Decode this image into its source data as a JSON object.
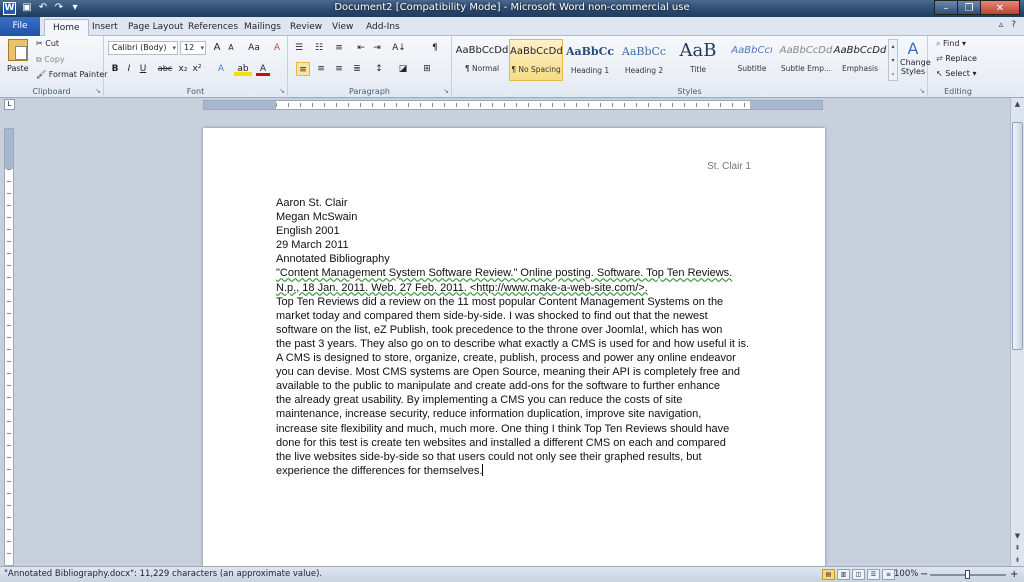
{
  "window": {
    "title": "Document2 [Compatibility Mode] - Microsoft Word non-commercial use",
    "app_icon": "W"
  },
  "tabs": [
    "File",
    "Home",
    "Insert",
    "Page Layout",
    "References",
    "Mailings",
    "Review",
    "View",
    "Add-Ins"
  ],
  "clipboard": {
    "paste": "Paste",
    "cut": "Cut",
    "copy": "Copy",
    "format_painter": "Format Painter",
    "label": "Clipboard"
  },
  "font": {
    "name": "Calibri (Body)",
    "size": "12",
    "label": "Font",
    "bold": "B",
    "italic": "I",
    "underline": "U",
    "strike": "abc",
    "sub": "x₂",
    "sup": "x²",
    "grow": "A",
    "shrink": "A",
    "case": "Aa",
    "clear": "A",
    "highlight": "ab",
    "color": "A"
  },
  "paragraph": {
    "label": "Paragraph",
    "show_marks": "¶",
    "sort": "A↓"
  },
  "styles": {
    "label": "Styles",
    "items": [
      {
        "preview": "AaBbCcDd",
        "name": "¶ Normal"
      },
      {
        "preview": "AaBbCcDd",
        "name": "¶ No Spacing"
      },
      {
        "preview": "AaBbCc",
        "name": "Heading 1"
      },
      {
        "preview": "AaBbCc",
        "name": "Heading 2"
      },
      {
        "preview": "AaB",
        "name": "Title"
      },
      {
        "preview": "AaBbCcı",
        "name": "Subtitle"
      },
      {
        "preview": "AaBbCcDd",
        "name": "Subtle Emp..."
      },
      {
        "preview": "AaBbCcDd",
        "name": "Emphasis"
      }
    ],
    "change_styles_1": "Change",
    "change_styles_2": "Styles"
  },
  "editing": {
    "label": "Editing",
    "find": "Find",
    "replace": "Replace",
    "select": "Select"
  },
  "document": {
    "header": "St. Clair 1",
    "lines": [
      "Aaron St. Clair",
      "Megan McSwain",
      "English 2001",
      "29 March 2011",
      "Annotated Bibliography",
      "\"Content Management System Software Review.\" Online posting. Software. Top Ten Reviews.",
      "N.p., 18 Jan. 2011. Web. 27 Feb. 2011. <http://www.make-a-web-site.com/>.",
      "Top Ten Reviews did a review on the 11 most popular Content Management Systems on the",
      "market today and compared them side-by-side. I was shocked to find out that the newest",
      "software on the list, eZ Publish, took precedence to the throne over Joomla!, which has won",
      "the past 3 years. They also go on to describe what exactly a CMS is used for and how useful it is.",
      "A CMS is designed to store, organize, create, publish, process and power any online endeavor",
      "you can devise. Most CMS systems are Open Source, meaning their API is completely free and",
      "available to the public to manipulate and create add-ons for the software to further enhance",
      "the already great usability. By implementing a CMS you can reduce the costs of site",
      "maintenance, increase security, reduce information duplication, improve site navigation,",
      "increase site flexibility and much, much more. One thing I think Top Ten Reviews should have",
      "done for this test is create ten websites and installed a different CMS on each and compared",
      "the live websites side-by-side so that users could not only see their graphed results, but",
      "experience the differences for themselves."
    ]
  },
  "status": {
    "text": "\"Annotated Bibliography.docx\": 11,229 characters (an approximate value).",
    "zoom": "100%",
    "minus": "−",
    "plus": "+"
  }
}
